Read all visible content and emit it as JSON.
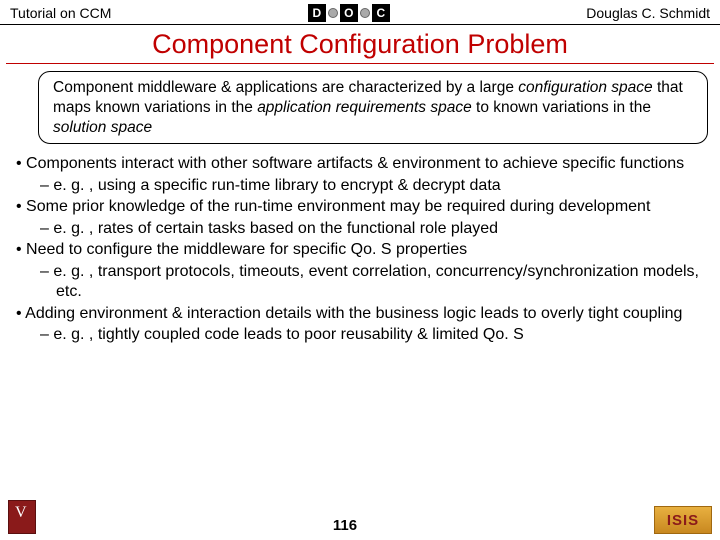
{
  "header": {
    "left": "Tutorial on CCM",
    "right": "Douglas C. Schmidt",
    "logo_letters": [
      "D",
      "O",
      "C"
    ]
  },
  "title": "Component Configuration Problem",
  "callout": {
    "line1_a": "Component middleware & applications are characterized by a large ",
    "line1_b": "configuration space",
    "line2_a": " that maps known variations in the ",
    "line2_b": "application requirements space",
    "line2_c": " to known variations in the ",
    "line2_d": "solution space"
  },
  "bullets": [
    {
      "lvl": 1,
      "text": "Components interact with other software artifacts & environment to achieve specific functions"
    },
    {
      "lvl": 2,
      "text": "e. g. , using a specific run-time library to encrypt & decrypt data"
    },
    {
      "lvl": 1,
      "text": "Some prior knowledge of the run-time environment may be required during development"
    },
    {
      "lvl": 2,
      "text": "e. g. , rates of certain tasks based on the functional role played"
    },
    {
      "lvl": 1,
      "text": "Need to configure the middleware for specific Qo. S properties"
    },
    {
      "lvl": 2,
      "text": "e. g. , transport protocols, timeouts, event correlation, concurrency/synchronization models, etc."
    },
    {
      "lvl": 1,
      "text": "Adding environment & interaction details with the business logic leads to overly tight coupling"
    },
    {
      "lvl": 3,
      "text": "e. g. , tightly coupled code leads to poor reusability & limited Qo. S"
    }
  ],
  "footer": {
    "page": "116",
    "right_logo_text": "ISIS"
  }
}
